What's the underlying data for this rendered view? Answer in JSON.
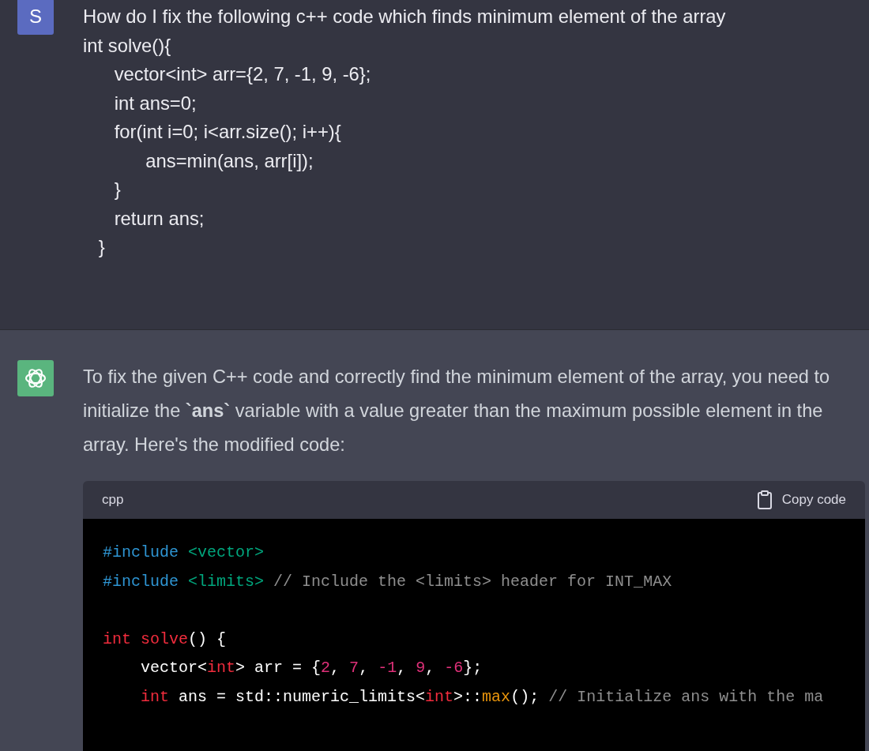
{
  "user_message": {
    "avatar": "S",
    "lines": [
      "How do I fix the following c++ code which finds minimum element of the array",
      "int solve(){",
      "      vector<int> arr={2, 7, -1, 9, -6};",
      "      int ans=0;",
      "      for(int i=0; i<arr.size(); i++){",
      "            ans=min(ans, arr[i]);",
      "      }",
      "      return ans;",
      "   }"
    ]
  },
  "assistant_message": {
    "text": "To fix the given C++ code and correctly find the minimum element of the array, you need to initialize the **`ans`** variable with a value greater than the maximum possible element in the array. Here's the modified code:",
    "code_block": {
      "language": "cpp",
      "copy_label": "Copy code",
      "groups": [
        [
          [
            {
              "text": "#include",
              "kind": "keyword"
            },
            {
              "text": " <vector>",
              "kind": "string"
            }
          ],
          [
            {
              "text": "#include",
              "kind": "keyword"
            },
            {
              "text": " <limits>",
              "kind": "string"
            },
            {
              "text": " // Include the <limits> header for INT_MAX",
              "kind": "comment"
            }
          ]
        ],
        [
          [
            {
              "text": "int solve",
              "kind": "type"
            },
            {
              "text": "() {",
              "kind": "plain"
            }
          ],
          [
            {
              "text": "    vector<",
              "kind": "plain"
            },
            {
              "text": "int",
              "kind": "type"
            },
            {
              "text": "> arr = {",
              "kind": "plain"
            },
            {
              "text": "2",
              "kind": "number"
            },
            {
              "text": ", ",
              "kind": "plain"
            },
            {
              "text": "7",
              "kind": "number"
            },
            {
              "text": ", ",
              "kind": "plain"
            },
            {
              "text": "-1",
              "kind": "number"
            },
            {
              "text": ", ",
              "kind": "plain"
            },
            {
              "text": "9",
              "kind": "number"
            },
            {
              "text": ", ",
              "kind": "plain"
            },
            {
              "text": "-6",
              "kind": "number"
            },
            {
              "text": "};",
              "kind": "plain"
            }
          ],
          [
            {
              "text": "    int",
              "kind": "type"
            },
            {
              "text": " ans = std::numeric_limits<",
              "kind": "plain"
            },
            {
              "text": "int",
              "kind": "type"
            },
            {
              "text": ">::",
              "kind": "plain"
            },
            {
              "text": "max",
              "kind": "builtin"
            },
            {
              "text": "(); ",
              "kind": "plain"
            },
            {
              "text": "// Initialize ans with the ma",
              "kind": "comment"
            }
          ]
        ]
      ]
    }
  }
}
